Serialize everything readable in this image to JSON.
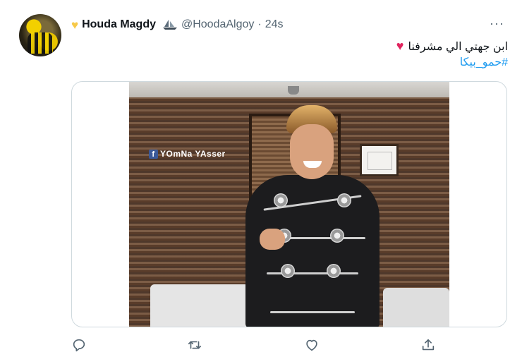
{
  "tweet": {
    "display_name": "Houda Magdy",
    "handle": "@HoodaAlgoy",
    "separator": "·",
    "time": "24s",
    "more_label": "···",
    "text": "ابن جهتي الي مشرفنا",
    "hashtag": "#حمو_بيكا",
    "name_emoji_icon": "yellow-heart-icon",
    "badge_icon": "ship-icon",
    "text_emoji_icon": "red-heart-icon"
  },
  "media": {
    "watermark": "YOmNa YAsser",
    "watermark_icon": "facebook-icon"
  },
  "actions": {
    "reply_icon": "reply-icon",
    "retweet_icon": "retweet-icon",
    "like_icon": "heart-icon",
    "share_icon": "share-icon"
  },
  "colors": {
    "link": "#1d9bf0",
    "muted": "#536471",
    "text": "#0f1419",
    "border": "#cfd9de"
  }
}
